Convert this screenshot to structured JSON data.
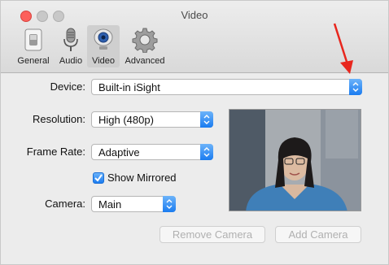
{
  "window": {
    "title": "Video"
  },
  "toolbar": {
    "tabs": [
      {
        "label": "General",
        "icon": "switch-icon"
      },
      {
        "label": "Audio",
        "icon": "microphone-icon"
      },
      {
        "label": "Video",
        "icon": "webcam-icon",
        "selected": true
      },
      {
        "label": "Advanced",
        "icon": "gear-icon"
      }
    ]
  },
  "form": {
    "device": {
      "label": "Device:",
      "value": "Built-in iSight"
    },
    "resolution": {
      "label": "Resolution:",
      "value": "High (480p)"
    },
    "frame_rate": {
      "label": "Frame Rate:",
      "value": "Adaptive"
    },
    "show_mirrored": {
      "label": "Show Mirrored",
      "checked": true
    },
    "camera": {
      "label": "Camera:",
      "value": "Main"
    }
  },
  "buttons": {
    "remove_camera": "Remove Camera",
    "add_camera": "Add Camera"
  },
  "colors": {
    "accent": "#1b7cf0",
    "annotation_arrow": "#e8261d"
  }
}
